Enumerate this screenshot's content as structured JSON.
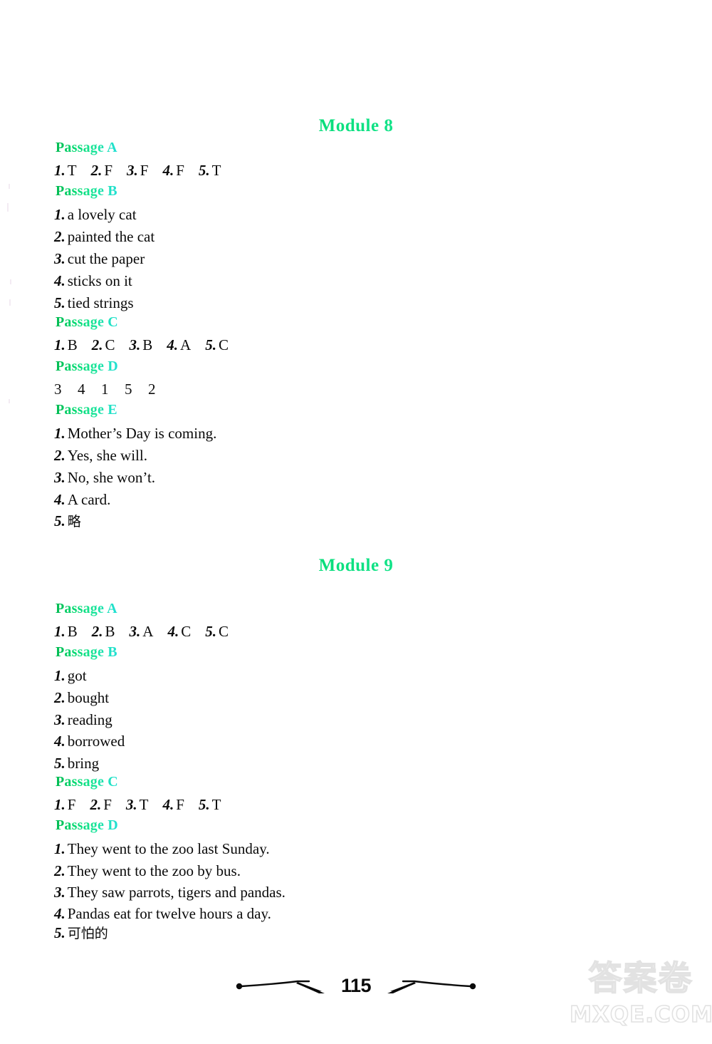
{
  "document": {
    "page_number": "115",
    "watermark": {
      "cjk_text": "答案卷",
      "domain_text": "MXQE.COM"
    },
    "colors": {
      "heading_green": "#00d46a",
      "heading_cyan": "#23e0d8",
      "body_text": "#0a0a0a",
      "watermark": "#e2e2e2",
      "page_background": "#ffffff"
    }
  },
  "modules": [
    {
      "title": "Module 8",
      "passages": [
        {
          "heading": "Passage A",
          "layout": "inline",
          "items": [
            {
              "num": "1.",
              "answer": "T"
            },
            {
              "num": "2.",
              "answer": "F"
            },
            {
              "num": "3.",
              "answer": "F"
            },
            {
              "num": "4.",
              "answer": "F"
            },
            {
              "num": "5.",
              "answer": "T"
            }
          ]
        },
        {
          "heading": "Passage B",
          "layout": "stacked",
          "items": [
            {
              "num": "1.",
              "answer": "a lovely cat"
            },
            {
              "num": "2.",
              "answer": "painted the cat"
            },
            {
              "num": "3.",
              "answer": "cut the paper"
            },
            {
              "num": "4.",
              "answer": "sticks on it"
            },
            {
              "num": "5.",
              "answer": "tied strings"
            }
          ]
        },
        {
          "heading": "Passage C",
          "layout": "inline",
          "items": [
            {
              "num": "1.",
              "answer": "B"
            },
            {
              "num": "2.",
              "answer": "C"
            },
            {
              "num": "3.",
              "answer": "B"
            },
            {
              "num": "4.",
              "answer": "A"
            },
            {
              "num": "5.",
              "answer": "C"
            }
          ]
        },
        {
          "heading": "Passage D",
          "layout": "sequence",
          "sequence": [
            "3",
            "4",
            "1",
            "5",
            "2"
          ]
        },
        {
          "heading": "Passage E",
          "layout": "stacked",
          "items": [
            {
              "num": "1.",
              "answer": "Mother’s Day is coming."
            },
            {
              "num": "2.",
              "answer": "Yes, she will."
            },
            {
              "num": "3.",
              "answer": "No, she won’t."
            },
            {
              "num": "4.",
              "answer": "A card."
            },
            {
              "num": "5.",
              "answer": "略",
              "cjk": true
            }
          ]
        }
      ]
    },
    {
      "title": "Module 9",
      "passages": [
        {
          "heading": "Passage A",
          "layout": "inline",
          "items": [
            {
              "num": "1.",
              "answer": "B"
            },
            {
              "num": "2.",
              "answer": "B"
            },
            {
              "num": "3.",
              "answer": "A"
            },
            {
              "num": "4.",
              "answer": "C"
            },
            {
              "num": "5.",
              "answer": "C"
            }
          ]
        },
        {
          "heading": "Passage B",
          "layout": "stacked",
          "items": [
            {
              "num": "1.",
              "answer": "got"
            },
            {
              "num": "2.",
              "answer": "bought"
            },
            {
              "num": "3.",
              "answer": "reading"
            },
            {
              "num": "4.",
              "answer": "borrowed"
            },
            {
              "num": "5.",
              "answer": "bring"
            }
          ]
        },
        {
          "heading": "Passage C",
          "layout": "inline",
          "items": [
            {
              "num": "1.",
              "answer": "F"
            },
            {
              "num": "2.",
              "answer": "F"
            },
            {
              "num": "3.",
              "answer": "T"
            },
            {
              "num": "4.",
              "answer": "F"
            },
            {
              "num": "5.",
              "answer": "T"
            }
          ]
        },
        {
          "heading": "Passage D",
          "layout": "stacked",
          "items": [
            {
              "num": "1.",
              "answer": "They went to the zoo last Sunday."
            },
            {
              "num": "2.",
              "answer": "They went to the zoo by bus."
            },
            {
              "num": "3.",
              "answer": "They saw parrots, tigers and pandas."
            },
            {
              "num": "4.",
              "answer": "Pandas eat for twelve hours a day."
            },
            {
              "num": "5.",
              "answer": "可怕的",
              "cjk": true
            }
          ]
        }
      ]
    }
  ]
}
